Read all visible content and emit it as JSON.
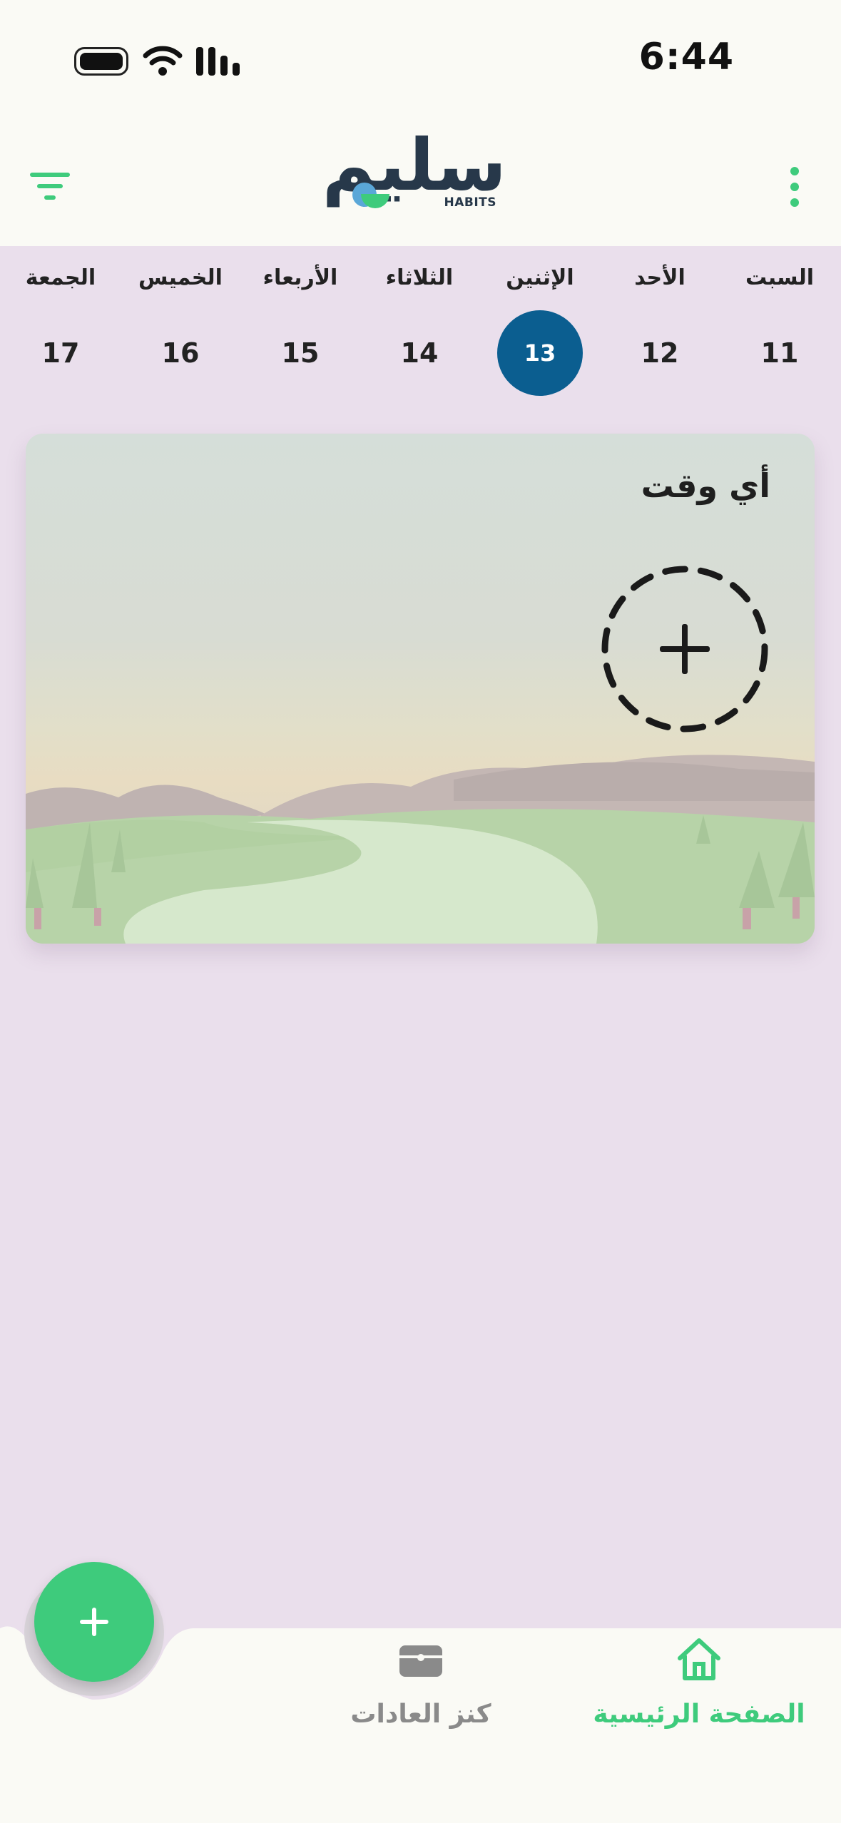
{
  "status_bar": {
    "time": "6:44"
  },
  "header": {
    "logo_text": "سليم",
    "logo_subtext": "HABITS"
  },
  "week": {
    "days": [
      {
        "name": "الجمعة",
        "number": "17",
        "selected": false
      },
      {
        "name": "الخميس",
        "number": "16",
        "selected": false
      },
      {
        "name": "الأربعاء",
        "number": "15",
        "selected": false
      },
      {
        "name": "الثلاثاء",
        "number": "14",
        "selected": false
      },
      {
        "name": "الإثنين",
        "number": "13",
        "selected": true
      },
      {
        "name": "الأحد",
        "number": "12",
        "selected": false
      },
      {
        "name": "السبت",
        "number": "11",
        "selected": false
      }
    ]
  },
  "card": {
    "title": "أي وقت"
  },
  "bottom_nav": {
    "home_label": "الصفحة الرئيسية",
    "treasure_label": "كنز العادات"
  },
  "colors": {
    "accent": "#3ECB7C",
    "selected_day": "#0B5E90",
    "background": "#EADFEC"
  }
}
